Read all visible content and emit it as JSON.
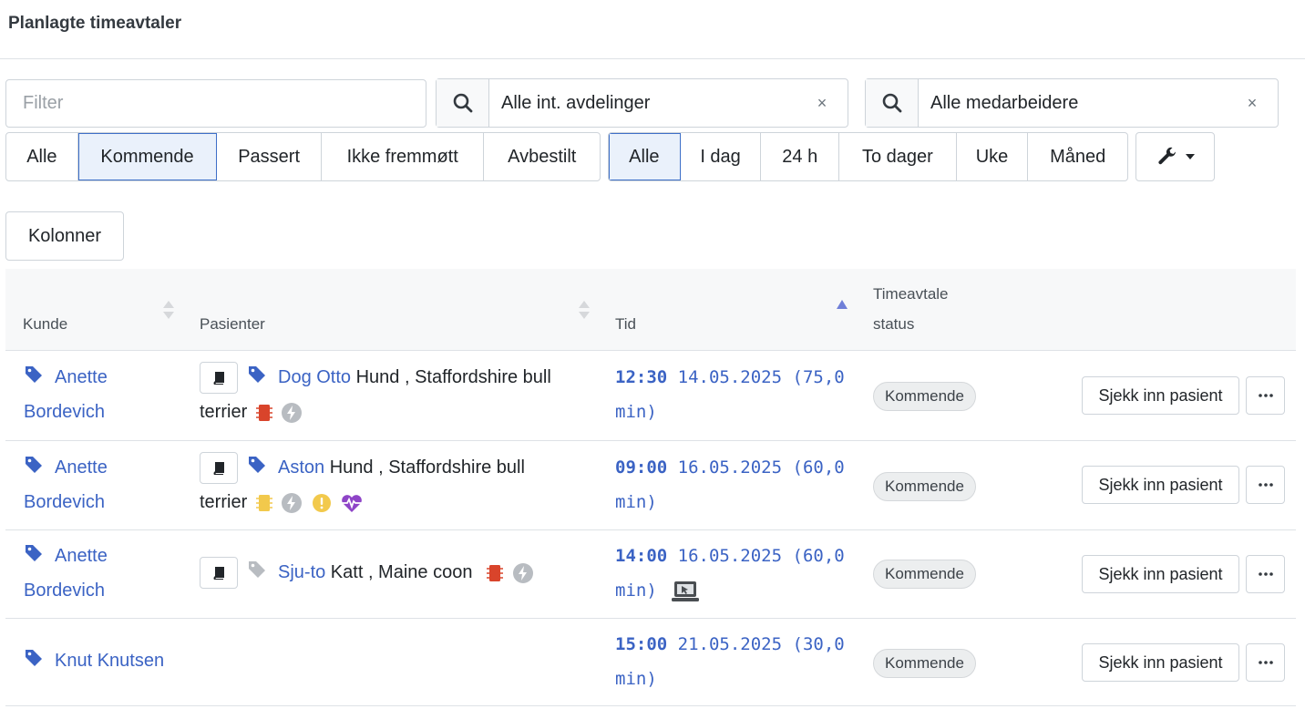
{
  "page": {
    "title": "Planlagte timeavtaler"
  },
  "filter": {
    "placeholder": "Filter"
  },
  "department_select": {
    "value": "Alle int. avdelinger",
    "clear": "×",
    "icon": "search-icon"
  },
  "employee_select": {
    "value": "Alle medarbeidere",
    "clear": "×",
    "icon": "search-icon"
  },
  "status_tabs": [
    {
      "label": "Alle",
      "active": false
    },
    {
      "label": "Kommende",
      "active": true
    },
    {
      "label": "Passert",
      "active": false
    },
    {
      "label": "Ikke fremmøtt",
      "active": false
    },
    {
      "label": "Avbestilt",
      "active": false
    }
  ],
  "period_tabs": [
    {
      "label": "Alle",
      "active": true
    },
    {
      "label": "I dag",
      "active": false
    },
    {
      "label": "24 h",
      "active": false
    },
    {
      "label": "To dager",
      "active": false
    },
    {
      "label": "Uke",
      "active": false
    },
    {
      "label": "Måned",
      "active": false
    }
  ],
  "tools_button": {
    "icon": "wrench-icon"
  },
  "columns_button": {
    "label": "Kolonner"
  },
  "table": {
    "headers": {
      "kunde": "Kunde",
      "pasienter": "Pasienter",
      "tid": "Tid",
      "status_line1": "Timeavtale",
      "status_line2": "status"
    },
    "rows": [
      {
        "customer_first": "Anette",
        "customer_last": "Bordevich",
        "patient_name": "Dog Otto",
        "patient_desc": " Hund , Staffordshire bull",
        "patient_desc2": "terrier",
        "time": "12:30",
        "date": "14.05.2025",
        "duration_a": "(75,0",
        "duration_b": "min)",
        "status": "Kommende",
        "checkin": "Sjekk inn pasient",
        "icons": [
          "chip-icon-red",
          "flash-icon"
        ]
      },
      {
        "customer_first": "Anette",
        "customer_last": "Bordevich",
        "patient_name": "Aston",
        "patient_desc": " Hund , Staffordshire bull",
        "patient_desc2": "terrier",
        "time": "09:00",
        "date": "16.05.2025",
        "duration_a": "(60,0",
        "duration_b": "min)",
        "status": "Kommende",
        "checkin": "Sjekk inn pasient",
        "icons": [
          "chip-icon-yellow",
          "flash-icon",
          "warning-icon",
          "heartbeat-icon"
        ]
      },
      {
        "customer_first": "Anette",
        "customer_last": "Bordevich",
        "patient_name": "Sju-to",
        "patient_desc": " Katt , Maine coon",
        "time": "14:00",
        "date": "16.05.2025",
        "duration_a": "(60,0",
        "duration_b": "min)",
        "status": "Kommende",
        "checkin": "Sjekk inn pasient",
        "icons": [
          "chip-icon-red",
          "flash-icon",
          "online-booking-icon"
        ]
      },
      {
        "customer_full": "Knut Knutsen",
        "time": "15:00",
        "date": "21.05.2025",
        "duration_a": "(30,0",
        "duration_b": "min)",
        "status": "Kommende",
        "checkin": "Sjekk inn pasient",
        "icons": []
      }
    ]
  },
  "colors": {
    "link": "#3b63c4",
    "active_border": "#3e6fc8",
    "chip_red": "#d9442b",
    "chip_yellow": "#f2c94c",
    "warning": "#f2c94c",
    "heartbeat": "#8e44c7"
  }
}
